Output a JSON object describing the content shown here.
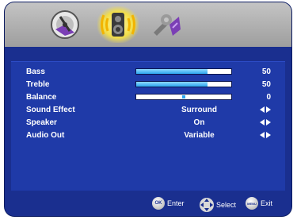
{
  "menu": {
    "tabs": [
      {
        "name": "picture",
        "icon": "picture-disc-icon",
        "active": false
      },
      {
        "name": "sound",
        "icon": "speaker-sound-icon",
        "active": true
      },
      {
        "name": "setup",
        "icon": "wrench-setup-icon",
        "active": false
      }
    ]
  },
  "sound": {
    "items": [
      {
        "label": "Bass",
        "type": "slider",
        "value": "50",
        "level": 0.75
      },
      {
        "label": "Treble",
        "type": "slider",
        "value": "50",
        "level": 0.75
      },
      {
        "label": "Balance",
        "type": "balance",
        "value": "0",
        "level": 0.5
      },
      {
        "label": "Sound Effect",
        "type": "option",
        "value": "Surround"
      },
      {
        "label": "Speaker",
        "type": "option",
        "value": "On"
      },
      {
        "label": "Audio Out",
        "type": "option",
        "value": "Variable"
      }
    ]
  },
  "footer": {
    "ok_key": "OK",
    "enter_label": "Enter",
    "select_label": "Select",
    "menu_key": "MENU",
    "exit_label": "Exit"
  },
  "colors": {
    "background": "#1a2f8f",
    "panel": "#1f3aa8",
    "slider_fill": "#2ca6ee",
    "active_tab": "#f3de48"
  }
}
